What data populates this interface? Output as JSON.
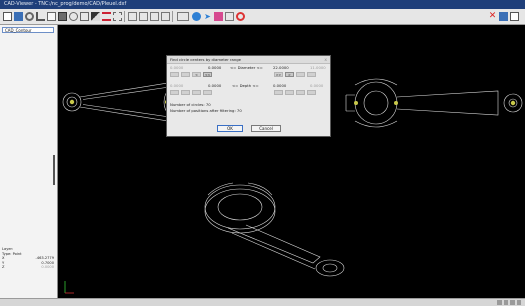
{
  "window": {
    "title": "CAD-Viewer - TNC:/nc_prog/demo/CAD/Pleuel.dxf"
  },
  "toolbar": {
    "icons": [
      "layer-icon",
      "open-file-icon",
      "set-reference-icon",
      "origin-icon",
      "contour-icon",
      "positions-icon",
      "hole-icon",
      "pattern-icon",
      "zoom-icon",
      "shift-icon",
      "grid-icon",
      "snap-icon",
      "settings-icon",
      "3d-view-icon",
      "move-icon",
      "color-icon",
      "select-icon",
      "undo-icon",
      "close-icon",
      "save-icon",
      "copy-icon"
    ],
    "accent": "#1f3f7a"
  },
  "left_panel": {
    "layer_label": "CAD_Contour",
    "info": {
      "heading": "Layer:",
      "type_label": "Type: Point",
      "rows": [
        {
          "axis": "X",
          "value": "-463.2779"
        },
        {
          "axis": "Y",
          "value": "0.7000"
        },
        {
          "axis": "Z",
          "value": "0.0000"
        }
      ]
    }
  },
  "dialog": {
    "title": "Find circle centers by diameter range",
    "close": "X",
    "diam_min_faded": "0.0000",
    "diam_min": "0.0000",
    "diam_op": "<= Diameter <=",
    "diam_max": "22.0000",
    "diam_max_faded": "11.0000",
    "depth_min_faded": "0.0000",
    "depth_min": "0.0000",
    "depth_op": "<= Depth <=",
    "depth_max": "0.0000",
    "depth_max_faded": "0.0000",
    "count_label": "Number of circles: 70",
    "filtered_label": "Number of positions after filtering: 70",
    "ok_label": "OK",
    "cancel_label": "Cancel",
    "step_buttons": {
      "row1_left": [
        "",
        "",
        "<",
        "<<"
      ],
      "row1_right": [
        ">>",
        ">",
        "",
        ""
      ]
    }
  },
  "status": {
    "right_text": ""
  }
}
